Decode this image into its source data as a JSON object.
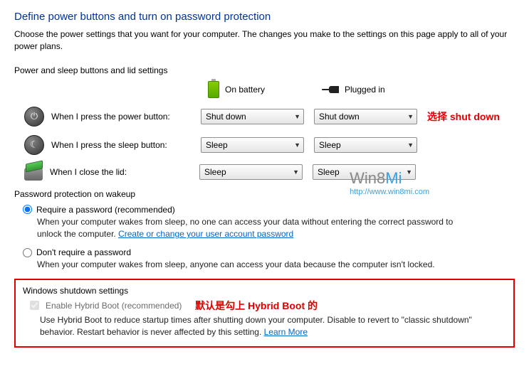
{
  "title": "Define power buttons and turn on password protection",
  "description": "Choose the power settings that you want for your computer. The changes you make to the settings on this page apply to all of your power plans.",
  "sections": {
    "buttons_lid_header": "Power and sleep buttons and lid settings",
    "col_battery": "On battery",
    "col_plugged": "Plugged in",
    "rows": {
      "power": {
        "label": "When I press the power button:",
        "battery": "Shut down",
        "plugged": "Shut down"
      },
      "sleep": {
        "label": "When I press the sleep button:",
        "battery": "Sleep",
        "plugged": "Sleep"
      },
      "lid": {
        "label": "When I close the lid:",
        "battery": "Sleep",
        "plugged": "Sleep"
      }
    }
  },
  "annotation1": "选择 shut down",
  "watermark": {
    "brand_a": "Win8",
    "brand_b": "Mi",
    "url": "http://www.win8mi.com"
  },
  "password": {
    "header": "Password protection on wakeup",
    "require_label": "Require a password (recommended)",
    "require_desc": "When your computer wakes from sleep, no one can access your data without entering the correct password to unlock the computer. ",
    "require_link": "Create or change your user account password",
    "dont_label": "Don't require a password",
    "dont_desc": "When your computer wakes from sleep, anyone can access your data because the computer isn't locked."
  },
  "shutdown": {
    "header": "Windows shutdown settings",
    "checkbox_label": "Enable Hybrid Boot (recommended)",
    "annotation2": "默认是勾上 Hybrid Boot 的",
    "desc": "Use Hybrid Boot to reduce startup times after shutting down your computer. Disable to revert to \"classic shutdown\" behavior. Restart behavior is never affected by this setting. ",
    "learn_more": "Learn More"
  }
}
